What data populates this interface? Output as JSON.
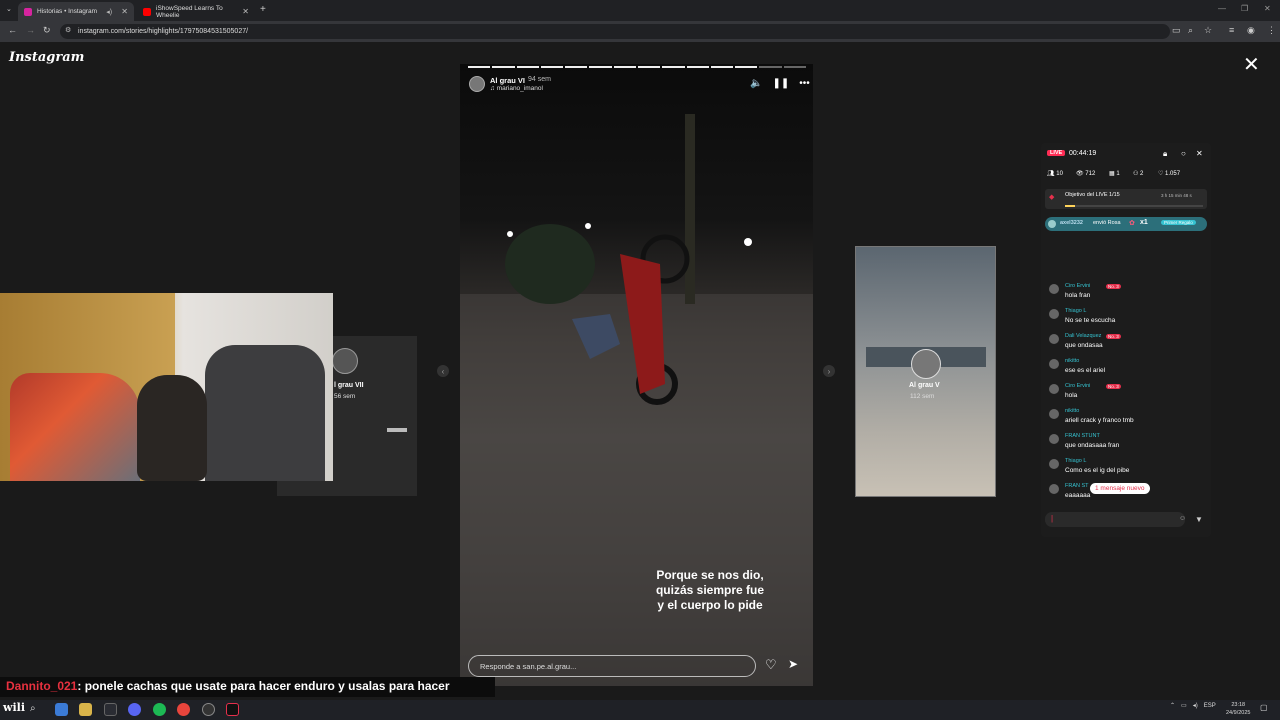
{
  "browser": {
    "tabs": [
      {
        "label": "Historias • Instagram",
        "active": true
      },
      {
        "label": "iShowSpeed Learns To Wheelie",
        "active": false
      }
    ],
    "url": "instagram.com/stories/highlights/17975084531505027/"
  },
  "instagram": {
    "logo": "Instagram",
    "close_icon": "✕",
    "story": {
      "username": "Al grau VI",
      "time": "94 sem",
      "music": "mariano_imanol",
      "caption_lines": [
        "Porque se nos dio,",
        "quizás siempre fue",
        "y el cuerpo lo pide"
      ],
      "reply_placeholder": "Responde a san.pe.al.grau...",
      "progress_total": 14,
      "progress_done": 12
    },
    "prev_story": {
      "title": "l grau VII",
      "time": "56 sem"
    },
    "next_story": {
      "title": "Al grau V",
      "time": "112 sem"
    }
  },
  "live": {
    "badge": "LIVE",
    "timer": "00:44:19",
    "stats": {
      "viewers_now": "10",
      "views": "712",
      "gifts": "1",
      "shares": "2",
      "likes": "1.057"
    },
    "goal": {
      "label": "Objetivo del LIVE 1/15",
      "time_left": "3 h 15 min 48 s",
      "progress": 0.07
    },
    "gift": {
      "user": "axel3232",
      "text": "envió Rosa",
      "count": "x1",
      "tag": "Primer Regalo"
    },
    "chat": [
      {
        "name": "Ciro Ervini",
        "badge": "No. 3",
        "msg": "hola fran"
      },
      {
        "name": "Thiago L",
        "badge": "",
        "msg": "No se te escucha"
      },
      {
        "name": "Dali Velazquez",
        "badge": "No. 3",
        "msg": "que ondasaa"
      },
      {
        "name": "nikitto",
        "badge": "",
        "msg": "ese es el ariel"
      },
      {
        "name": "Ciro Ervini",
        "badge": "No. 3",
        "msg": "hola"
      },
      {
        "name": "nikitto",
        "badge": "",
        "msg": "ariell crack y franco tmb"
      },
      {
        "name": "FRAN STUNT",
        "badge": "",
        "msg": "que ondasaaa fran"
      },
      {
        "name": "Thiago L",
        "badge": "",
        "msg": "Como es el ig del pibe"
      },
      {
        "name": "FRAN ST",
        "badge": "",
        "msg": "eaaaaaa"
      }
    ],
    "new_messages": "1 mensaje nuevo"
  },
  "overlay_chat": {
    "user": "Dannito_021",
    "message": ": ponele cachas que usate para hacer enduro y usalas para hacer"
  },
  "taskbar": {
    "lang": "ESP",
    "time": "23:18",
    "date": "24/9/2025"
  },
  "colors": {
    "live_red": "#ff2d55",
    "chat_name": "#36c3d1",
    "overlay_user": "#e8313f"
  }
}
